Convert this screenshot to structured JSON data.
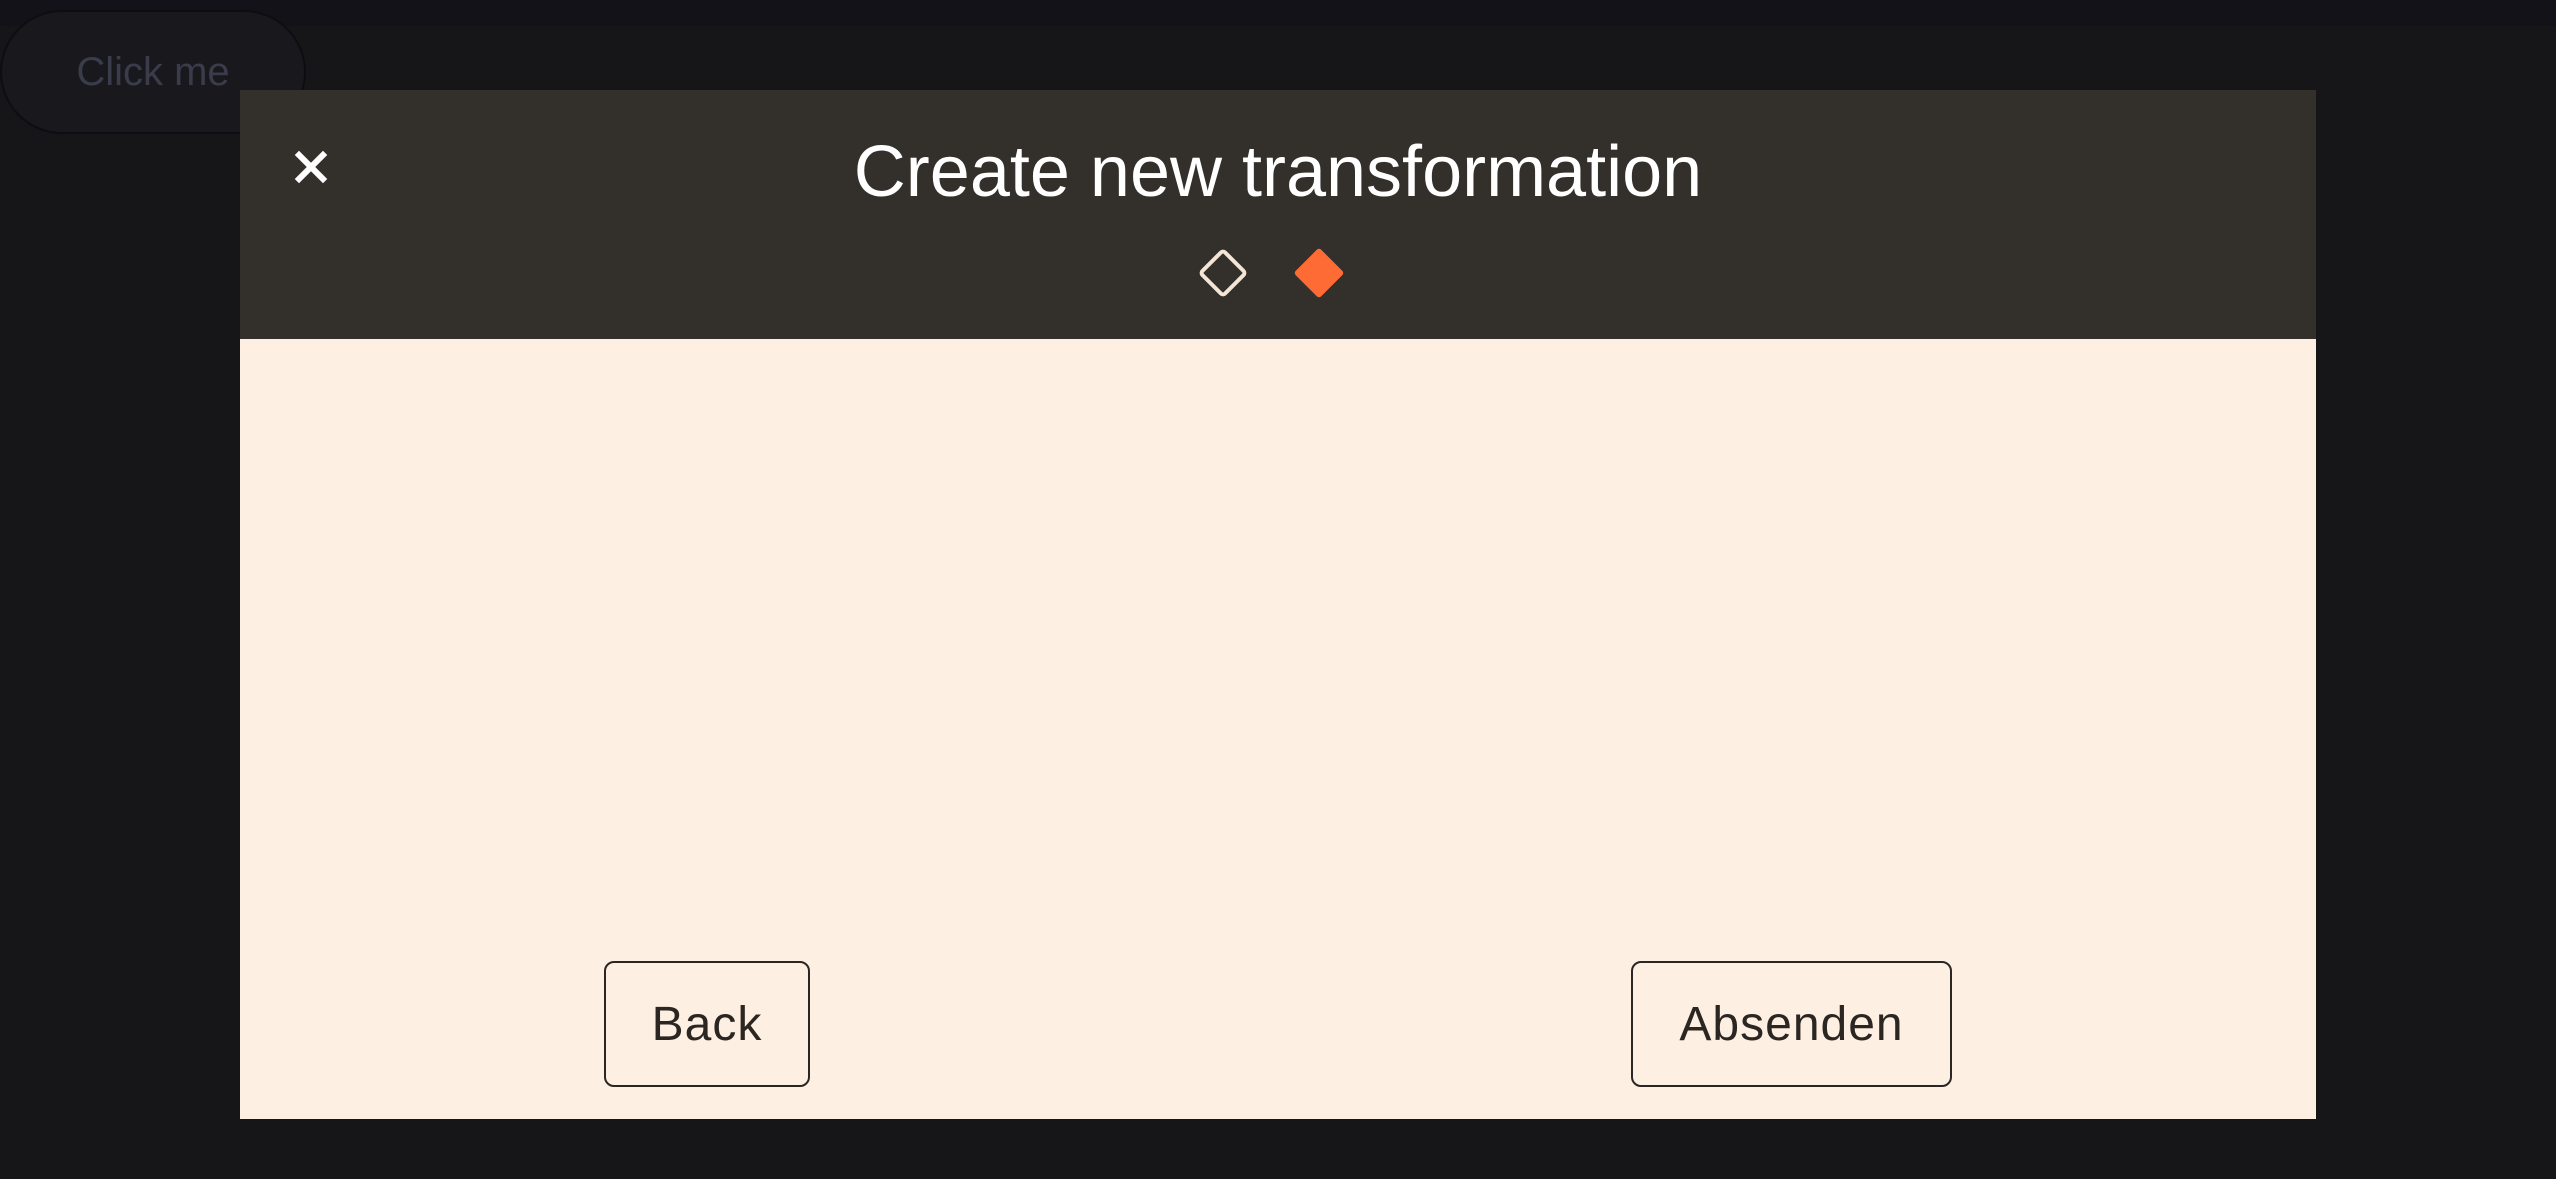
{
  "background": {
    "button_label": "Click me"
  },
  "modal": {
    "title": "Create new transformation",
    "close_icon": "close-icon",
    "steps": [
      {
        "state": "completed",
        "icon": "diamond-outline-icon"
      },
      {
        "state": "current",
        "icon": "diamond-filled-icon"
      }
    ],
    "back_label": "Back",
    "submit_label": "Absenden"
  },
  "colors": {
    "header_bg": "#332f2a",
    "body_bg": "#fdefe2",
    "accent": "#ff6b35",
    "page_bg": "#161618"
  }
}
